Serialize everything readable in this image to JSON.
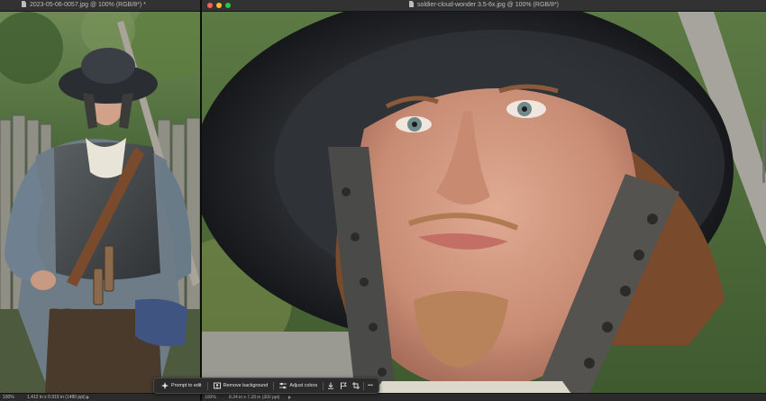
{
  "left_window": {
    "title": "2023-05-06-0057.jpg @ 100% (RGB/8*) *",
    "status": {
      "zoom": "100%",
      "dimensions": "1.412 in x 0.919 in (1480 ppi)"
    }
  },
  "right_window": {
    "title": "soldier-cloud-wonder 3.5-6x.jpg @ 100% (RGB/8*)",
    "status": {
      "zoom": "100%",
      "dimensions": "8.34 in x 7.28 in (300 ppi)"
    },
    "traffic_lights": {
      "close": "#ff5f57",
      "minimize": "#febc2e",
      "zoom": "#28c840"
    }
  },
  "contextual_taskbar": {
    "prompt_label": "Prompt to edit",
    "remove_bg_label": "Remove background",
    "adjust_colors_label": "Adjust colors",
    "more_label": "•••",
    "icons": [
      "sparkle-icon",
      "image-person-icon",
      "sliders-icon",
      "download-icon",
      "flag-icon",
      "crop-icon",
      "more-icon"
    ]
  },
  "colors": {
    "app_bg": "#1e1e1e",
    "titlebar": "#323232",
    "accent": "#3d8ae8"
  }
}
